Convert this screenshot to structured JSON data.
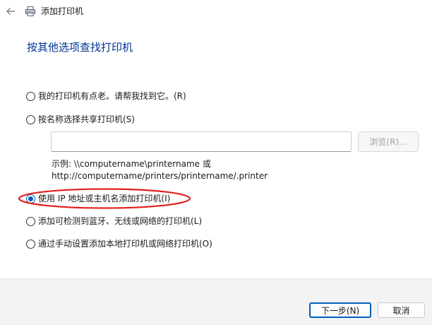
{
  "window": {
    "title": "添加打印机",
    "back_icon": "arrow-left-icon",
    "app_icon": "printer-icon"
  },
  "heading": "按其他选项查找打印机",
  "options": [
    {
      "label": "我的打印机有点老。请帮我找到它。(R)",
      "checked": false
    },
    {
      "label": "按名称选择共享打印机(S)",
      "checked": false
    },
    {
      "label": "使用 IP 地址或主机名添加打印机(I)",
      "checked": true
    },
    {
      "label": "添加可检测到蓝牙、无线或网络的打印机(L)",
      "checked": false
    },
    {
      "label": "通过手动设置添加本地打印机或网络打印机(O)",
      "checked": false
    }
  ],
  "shared_printer": {
    "input_value": "",
    "browse_label": "浏览(R)...",
    "example_line1": "示例: \\\\computername\\printername 或",
    "example_line2": "http://computername/printers/printername/.printer"
  },
  "footer": {
    "next_label": "下一步(N)",
    "cancel_label": "取消"
  },
  "colors": {
    "heading": "#003399",
    "accent": "#005fb8",
    "annotation": "#e0201b",
    "footer_bg": "#f3f3f3"
  }
}
